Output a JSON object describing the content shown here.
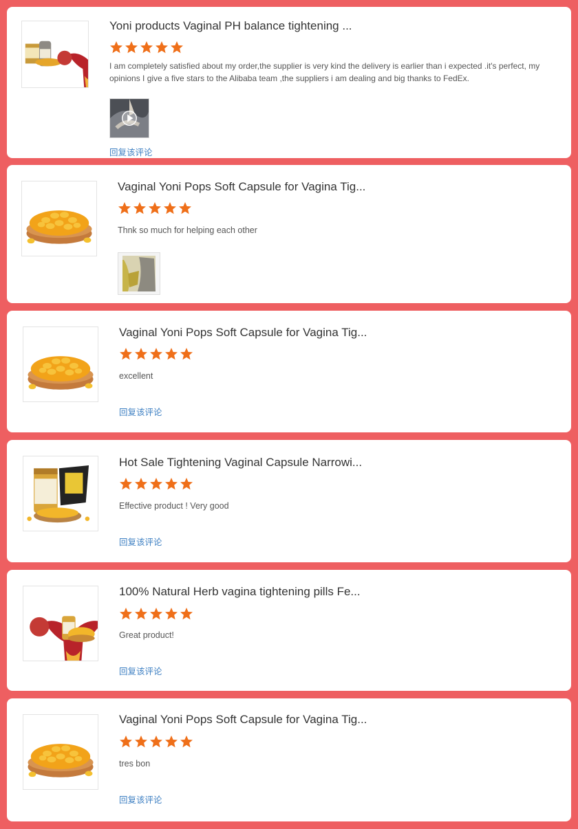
{
  "colors": {
    "background": "#ee5f61",
    "star": "#ef6f19",
    "link": "#3d7fc2"
  },
  "reviews": [
    {
      "title": "Yoni products Vaginal PH balance tightening ...",
      "rating": 5,
      "comment": "I am completely satisfied about my order,the supplier is  very kind the delivery is earlier than i expected .it's perfect, my opinions I give a five stars to the Alibaba team ,the suppliers i am dealing and big thanks to FedEx.",
      "thumbnail": "yoni-products-with-uterus-icon",
      "media": "video-thumbnail-play-icon",
      "reply_label": "回复该评论"
    },
    {
      "title": "Vaginal Yoni Pops Soft Capsule for Vagina Tig...",
      "rating": 5,
      "comment": "Thnk so much for helping each other",
      "thumbnail": "capsule-bowl-image",
      "media": "photo-thumbnail"
    },
    {
      "title": "Vaginal Yoni Pops Soft Capsule for Vagina Tig...",
      "rating": 5,
      "comment": "excellent",
      "thumbnail": "capsule-bowl-image",
      "reply_label": "回复该评论"
    },
    {
      "title": "Hot Sale Tightening Vaginal Capsule Narrowi...",
      "rating": 5,
      "comment": "Effective product ! Very good",
      "thumbnail": "capsule-bottle-pack-image",
      "reply_label": "回复该评论"
    },
    {
      "title": "100% Natural Herb vagina tightening pills Fe...",
      "rating": 5,
      "comment": "Great product!",
      "thumbnail": "uterus-bottle-image",
      "reply_label": "回复该评论"
    },
    {
      "title": "Vaginal Yoni Pops Soft Capsule for Vagina Tig...",
      "rating": 5,
      "comment": "tres bon",
      "thumbnail": "capsule-bowl-image",
      "reply_label": "回复该评论"
    }
  ]
}
